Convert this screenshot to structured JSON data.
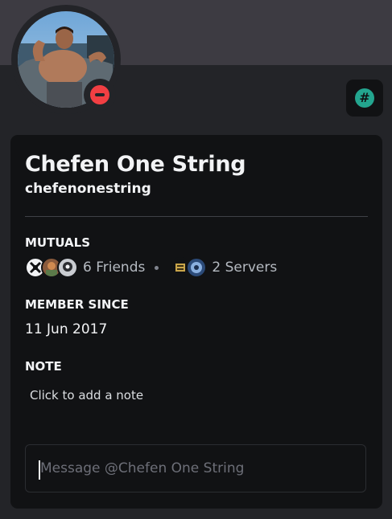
{
  "profile": {
    "display_name": "Chefen One String",
    "username": "chefenonestring",
    "status": "dnd",
    "status_color": "#f23f43",
    "avatar_icon": "avatar-photo"
  },
  "badge": {
    "icon": "hashtag-icon",
    "glyph": "#",
    "color": "#23a58f"
  },
  "mutuals": {
    "title": "MUTUALS",
    "friends_label": "6 Friends",
    "servers_label": "2 Servers",
    "separator": "•"
  },
  "member_since": {
    "title": "MEMBER SINCE",
    "date": "11 Jun 2017"
  },
  "note": {
    "title": "NOTE",
    "placeholder": "Click to add a note"
  },
  "message": {
    "placeholder": "Message @Chefen One String"
  }
}
